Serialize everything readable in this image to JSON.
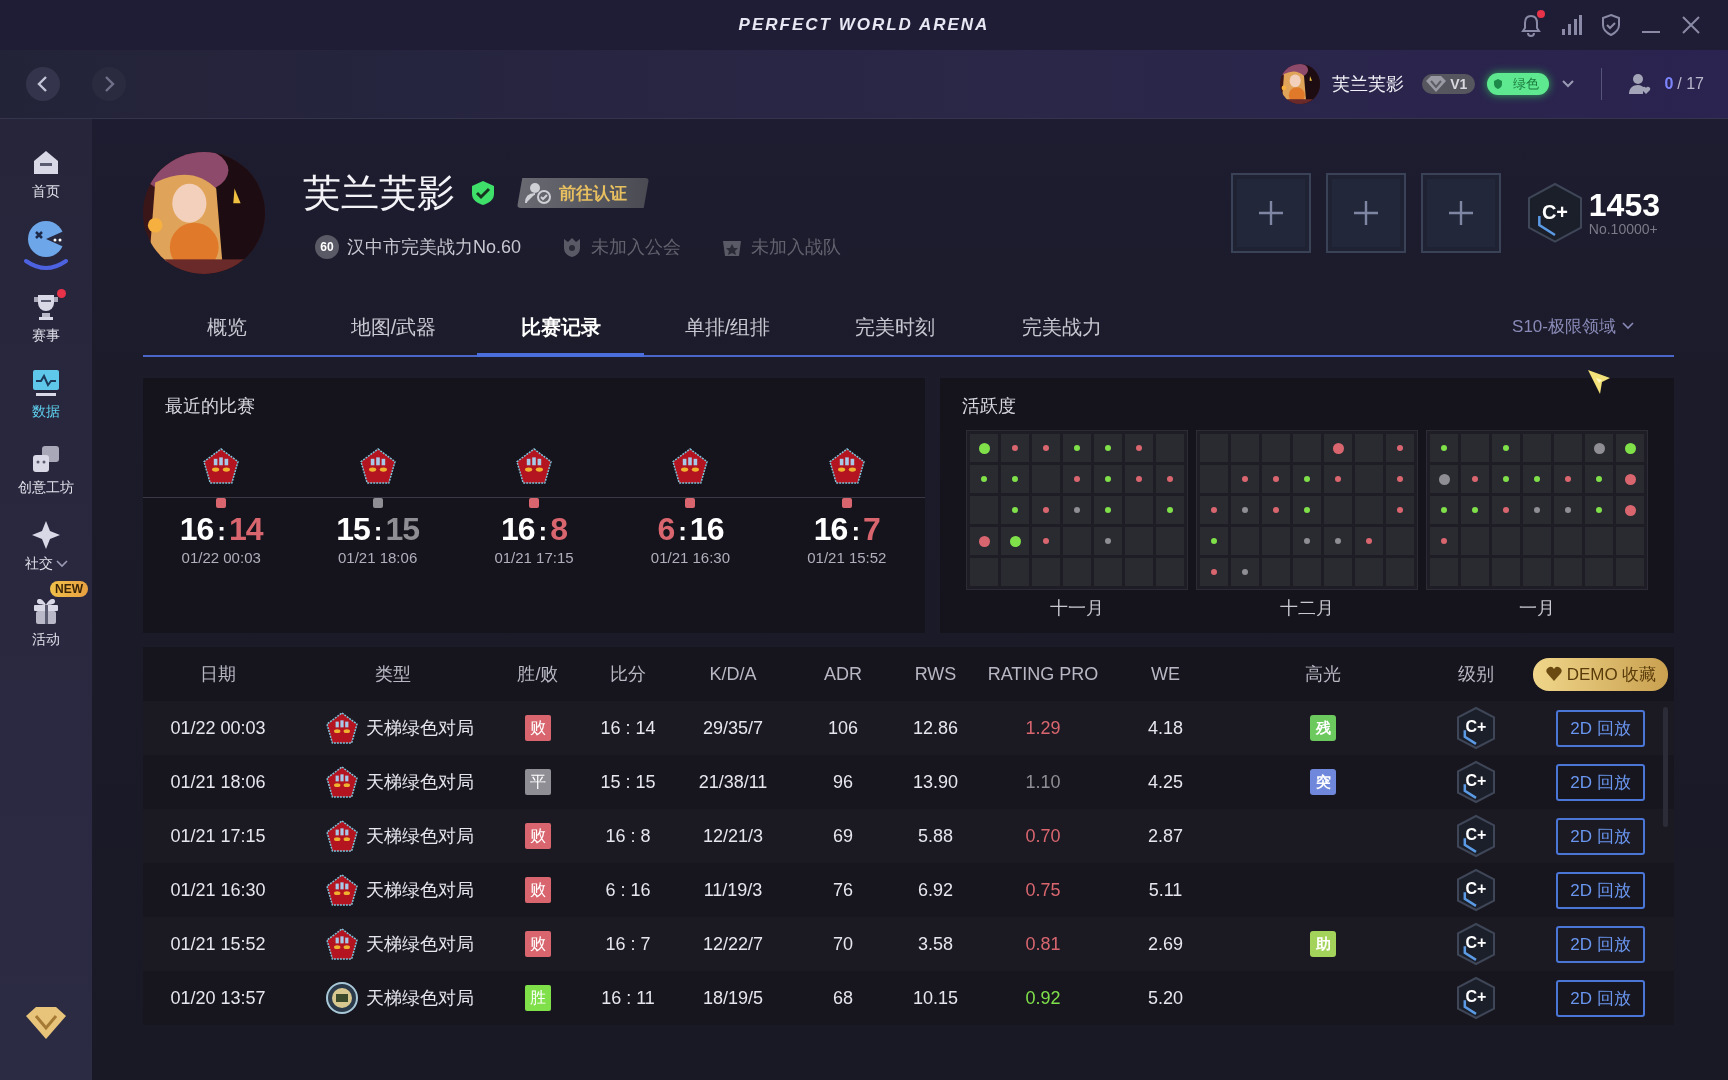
{
  "title_bar": {
    "title": "PERFECT WORLD ARENA",
    "notification": true
  },
  "top_bar": {
    "user_name": "芙兰芙影",
    "vip": "V1",
    "trust": "绿色",
    "friends_online": "0",
    "friends_total": "/ 17"
  },
  "sidebar": {
    "items": [
      {
        "label": "首页",
        "selected": false,
        "dot": false,
        "expandable": false
      },
      {
        "label": "赛事",
        "selected": false,
        "dot": true,
        "expandable": false
      },
      {
        "label": "数据",
        "selected": true,
        "dot": false,
        "expandable": false
      },
      {
        "label": "创意工坊",
        "selected": false,
        "dot": false,
        "expandable": false
      },
      {
        "label": "社交",
        "selected": false,
        "dot": false,
        "expandable": true
      },
      {
        "label": "活动",
        "selected": false,
        "dot": false,
        "expandable": false,
        "badge": "NEW"
      }
    ]
  },
  "profile": {
    "name": "芙兰芙影",
    "verify_button": "前往认证",
    "power_rank": "60",
    "power_text": "汉中市完美战力No.60",
    "guild": "未加入公会",
    "team": "未加入战队",
    "slots": [
      {
        "filled": false
      },
      {
        "filled": false
      },
      {
        "filled": false
      }
    ],
    "rating": {
      "grade": "C+",
      "score": "1453",
      "rank": "No.10000+"
    }
  },
  "tabs": [
    {
      "label": "概览",
      "selected": false
    },
    {
      "label": "地图/武器",
      "selected": false
    },
    {
      "label": "比赛记录",
      "selected": true
    },
    {
      "label": "单排/组排",
      "selected": false
    },
    {
      "label": "完美时刻",
      "selected": false
    },
    {
      "label": "完美战力",
      "selected": false
    }
  ],
  "season": "S10-极限领域",
  "recent": {
    "title": "最近的比赛",
    "matches": [
      {
        "color": "#d9666f",
        "score": [
          {
            "text": "16",
            "marked": false
          },
          {
            "text": ":",
            "marked": false
          },
          {
            "text": "14",
            "marked": true
          }
        ],
        "date": "01/22 00:03"
      },
      {
        "color": "#8e8e94",
        "score": [
          {
            "text": "15",
            "marked": false
          },
          {
            "text": ":",
            "marked": false
          },
          {
            "text": "15",
            "marked": true
          }
        ],
        "date": "01/21 18:06"
      },
      {
        "color": "#d9666f",
        "score": [
          {
            "text": "16",
            "marked": false
          },
          {
            "text": ":",
            "marked": false
          },
          {
            "text": "8",
            "marked": true
          }
        ],
        "date": "01/21 17:15"
      },
      {
        "color": "#d9666f",
        "score": [
          {
            "text": "6",
            "marked": true
          },
          {
            "text": ":",
            "marked": false
          },
          {
            "text": "16",
            "marked": false
          }
        ],
        "date": "01/21 16:30"
      },
      {
        "color": "#d9666f",
        "score": [
          {
            "text": "16",
            "marked": false
          },
          {
            "text": ":",
            "marked": false
          },
          {
            "text": "7",
            "marked": true
          }
        ],
        "date": "01/21 15:52"
      }
    ]
  },
  "activity": {
    "title": "活跃度",
    "months": [
      {
        "label": "十一月",
        "weeks": [
          [
            {
              "dot": true,
              "color": "#7fe04a",
              "big": true
            },
            {
              "dot": true,
              "color": "#d9666f",
              "big": false
            },
            {
              "dot": true,
              "color": "#d9666f",
              "big": false
            },
            {
              "dot": true,
              "color": "#7fe04a",
              "big": false
            },
            {
              "dot": true,
              "color": "#7fe04a",
              "big": false
            },
            {
              "dot": true,
              "color": "#d9666f",
              "big": false
            },
            {
              "dot": false
            }
          ],
          [
            {
              "dot": true,
              "color": "#7fe04a",
              "big": false
            },
            {
              "dot": true,
              "color": "#7fe04a",
              "big": false
            },
            {
              "dot": false
            },
            {
              "dot": true,
              "color": "#d9666f",
              "big": false
            },
            {
              "dot": true,
              "color": "#7fe04a",
              "big": false
            },
            {
              "dot": true,
              "color": "#d9666f",
              "big": false
            },
            {
              "dot": true,
              "color": "#d9666f",
              "big": false
            }
          ],
          [
            {
              "dot": false
            },
            {
              "dot": true,
              "color": "#7fe04a",
              "big": false
            },
            {
              "dot": true,
              "color": "#d9666f",
              "big": false
            },
            {
              "dot": true,
              "color": "#8e8e94",
              "big": false
            },
            {
              "dot": true,
              "color": "#7fe04a",
              "big": false
            },
            {
              "dot": false
            },
            {
              "dot": true,
              "color": "#7fe04a",
              "big": false
            }
          ],
          [
            {
              "dot": true,
              "color": "#d9666f",
              "big": true
            },
            {
              "dot": true,
              "color": "#7fe04a",
              "big": true
            },
            {
              "dot": true,
              "color": "#d9666f",
              "big": false
            },
            {
              "dot": false
            },
            {
              "dot": true,
              "color": "#8e8e94",
              "big": false
            },
            {
              "dot": false
            },
            {
              "dot": false
            }
          ],
          [
            {
              "dot": false
            },
            {
              "dot": false
            },
            {
              "dot": false
            },
            {
              "dot": false
            },
            {
              "dot": false
            },
            {
              "dot": false
            },
            {
              "dot": false
            }
          ]
        ]
      },
      {
        "label": "十二月",
        "weeks": [
          [
            {
              "dot": false
            },
            {
              "dot": false
            },
            {
              "dot": false
            },
            {
              "dot": false
            },
            {
              "dot": true,
              "color": "#d9666f",
              "big": true
            },
            {
              "dot": false
            },
            {
              "dot": true,
              "color": "#d9666f",
              "big": false
            }
          ],
          [
            {
              "dot": false
            },
            {
              "dot": true,
              "color": "#d9666f",
              "big": false
            },
            {
              "dot": true,
              "color": "#d9666f",
              "big": false
            },
            {
              "dot": true,
              "color": "#7fe04a",
              "big": false
            },
            {
              "dot": true,
              "color": "#d9666f",
              "big": false
            },
            {
              "dot": false
            },
            {
              "dot": true,
              "color": "#d9666f",
              "big": false
            }
          ],
          [
            {
              "dot": true,
              "color": "#d9666f",
              "big": false
            },
            {
              "dot": true,
              "color": "#8e8e94",
              "big": false
            },
            {
              "dot": true,
              "color": "#d9666f",
              "big": false
            },
            {
              "dot": true,
              "color": "#7fe04a",
              "big": false
            },
            {
              "dot": false
            },
            {
              "dot": false
            },
            {
              "dot": true,
              "color": "#d9666f",
              "big": false
            }
          ],
          [
            {
              "dot": true,
              "color": "#7fe04a",
              "big": false
            },
            {
              "dot": false
            },
            {
              "dot": false
            },
            {
              "dot": true,
              "color": "#8e8e94",
              "big": false
            },
            {
              "dot": true,
              "color": "#8e8e94",
              "big": false
            },
            {
              "dot": true,
              "color": "#d9666f",
              "big": false
            },
            {
              "dot": false
            }
          ],
          [
            {
              "dot": true,
              "color": "#d9666f",
              "big": false
            },
            {
              "dot": true,
              "color": "#8e8e94",
              "big": false
            },
            {
              "dot": false
            },
            {
              "dot": false
            },
            {
              "dot": false
            },
            {
              "dot": false
            },
            {
              "dot": false
            }
          ]
        ]
      },
      {
        "label": "一月",
        "weeks": [
          [
            {
              "dot": true,
              "color": "#7fe04a",
              "big": false
            },
            {
              "dot": false
            },
            {
              "dot": true,
              "color": "#7fe04a",
              "big": false
            },
            {
              "dot": false
            },
            {
              "dot": false
            },
            {
              "dot": true,
              "color": "#8e8e94",
              "big": true
            },
            {
              "dot": true,
              "color": "#7fe04a",
              "big": true
            }
          ],
          [
            {
              "dot": true,
              "color": "#8e8e94",
              "big": true
            },
            {
              "dot": true,
              "color": "#d9666f",
              "big": false
            },
            {
              "dot": true,
              "color": "#7fe04a",
              "big": false
            },
            {
              "dot": true,
              "color": "#7fe04a",
              "big": false
            },
            {
              "dot": true,
              "color": "#d9666f",
              "big": false
            },
            {
              "dot": true,
              "color": "#7fe04a",
              "big": false
            },
            {
              "dot": true,
              "color": "#d9666f",
              "big": true
            }
          ],
          [
            {
              "dot": true,
              "color": "#7fe04a",
              "big": false
            },
            {
              "dot": true,
              "color": "#7fe04a",
              "big": false
            },
            {
              "dot": true,
              "color": "#d9666f",
              "big": false
            },
            {
              "dot": true,
              "color": "#8e8e94",
              "big": false
            },
            {
              "dot": true,
              "color": "#8e8e94",
              "big": false
            },
            {
              "dot": true,
              "color": "#7fe04a",
              "big": false
            },
            {
              "dot": true,
              "color": "#d9666f",
              "big": true
            }
          ],
          [
            {
              "dot": true,
              "color": "#d9666f",
              "big": false
            },
            {
              "dot": false
            },
            {
              "dot": false
            },
            {
              "dot": false
            },
            {
              "dot": false
            },
            {
              "dot": false
            },
            {
              "dot": false
            }
          ],
          [
            {
              "dot": false
            },
            {
              "dot": false
            },
            {
              "dot": false
            },
            {
              "dot": false
            },
            {
              "dot": false
            },
            {
              "dot": false
            },
            {
              "dot": false
            }
          ]
        ]
      }
    ]
  },
  "table": {
    "columns": [
      "日期",
      "类型",
      "胜/败",
      "比分",
      "K/D/A",
      "ADR",
      "RWS",
      "RATING PRO",
      "WE",
      "高光",
      "级别"
    ],
    "demo_button": "DEMO 收藏",
    "rows": [
      {
        "date": "01/22 00:03",
        "kind": "pentagon",
        "mode": "天梯绿色对局",
        "result": {
          "text": "败",
          "color": "#d9666f"
        },
        "score": "16 : 14",
        "kda": "29/35/7",
        "adr": "106",
        "rws": "12.86",
        "rating": {
          "text": "1.29",
          "color": "#d9666f"
        },
        "we": "4.18",
        "highlight": {
          "text": "残",
          "color": "#6cc95e"
        },
        "grade": "C+",
        "button": "2D 回放"
      },
      {
        "date": "01/21 18:06",
        "kind": "pentagon",
        "mode": "天梯绿色对局",
        "result": {
          "text": "平",
          "color": "#8e8e94"
        },
        "score": "15 : 15",
        "kda": "21/38/11",
        "adr": "96",
        "rws": "13.90",
        "rating": {
          "text": "1.10",
          "color": "#8e8e94"
        },
        "we": "4.25",
        "highlight": {
          "text": "突",
          "color": "#6f88dc"
        },
        "grade": "C+",
        "button": "2D 回放"
      },
      {
        "date": "01/21 17:15",
        "kind": "pentagon",
        "mode": "天梯绿色对局",
        "result": {
          "text": "败",
          "color": "#d9666f"
        },
        "score": "16 : 8",
        "kda": "12/21/3",
        "adr": "69",
        "rws": "5.88",
        "rating": {
          "text": "0.70",
          "color": "#d9666f"
        },
        "we": "2.87",
        "grade": "C+",
        "button": "2D 回放"
      },
      {
        "date": "01/21 16:30",
        "kind": "pentagon",
        "mode": "天梯绿色对局",
        "result": {
          "text": "败",
          "color": "#d9666f"
        },
        "score": "6 : 16",
        "kda": "11/19/3",
        "adr": "76",
        "rws": "6.92",
        "rating": {
          "text": "0.75",
          "color": "#d9666f"
        },
        "we": "5.11",
        "grade": "C+",
        "button": "2D 回放"
      },
      {
        "date": "01/21 15:52",
        "kind": "pentagon",
        "mode": "天梯绿色对局",
        "result": {
          "text": "败",
          "color": "#d9666f"
        },
        "score": "16 : 7",
        "kda": "12/22/7",
        "adr": "70",
        "rws": "3.58",
        "rating": {
          "text": "0.81",
          "color": "#d9666f"
        },
        "we": "2.69",
        "highlight": {
          "text": "助",
          "color": "#a3d35a"
        },
        "grade": "C+",
        "button": "2D 回放"
      },
      {
        "date": "01/20 13:57",
        "kind": "round",
        "mode": "天梯绿色对局",
        "result": {
          "text": "胜",
          "color": "#7fe04a"
        },
        "score": "16 : 11",
        "kda": "18/19/5",
        "adr": "68",
        "rws": "10.15",
        "rating": {
          "text": "0.92",
          "color": "#7fe04a"
        },
        "we": "5.20",
        "grade": "C+",
        "button": "2D 回放"
      }
    ]
  }
}
